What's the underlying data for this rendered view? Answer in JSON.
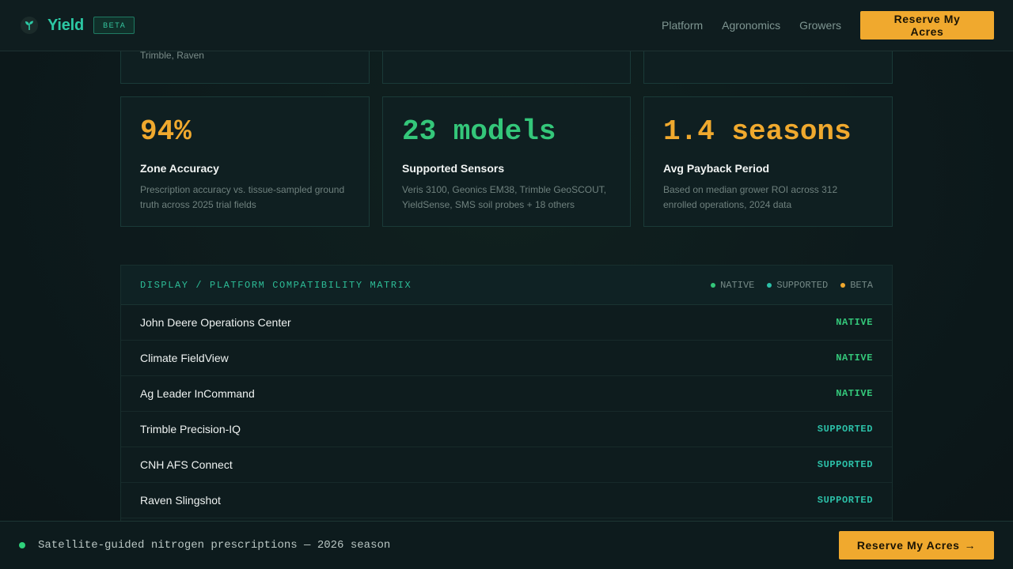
{
  "colors": {
    "accent": "#2cc8a4",
    "cta": "#f0a92e",
    "native": "#34c77a",
    "supported": "#2cc0a8",
    "beta": "#f0a92e",
    "stat_orange": "#f0a92e",
    "stat_green": "#34c77a"
  },
  "nav": {
    "logo_icon": "sprout-icon",
    "brand": "Yield",
    "badge": "BETA",
    "links": [
      "Platform",
      "Agronomics",
      "Growers"
    ],
    "cta_label": "Reserve My Acres"
  },
  "partial_cards": [
    {
      "text": "Trimble, Raven"
    },
    {
      "text": ""
    },
    {
      "text": ""
    }
  ],
  "stats": [
    {
      "value": "94%",
      "label": "Zone Accuracy",
      "desc": "Prescription accuracy vs. tissue-sampled ground truth across 2025 trial fields",
      "color": "#f0a92e"
    },
    {
      "value": "23 models",
      "label": "Supported Sensors",
      "desc": "Veris 3100, Geonics EM38, Trimble GeoSCOUT, YieldSense, SMS soil probes + 18 others",
      "color": "#34c77a"
    },
    {
      "value": "1.4 seasons",
      "label": "Avg Payback Period",
      "desc": "Based on median grower ROI across 312 enrolled operations, 2024 data",
      "color": "#f0a92e"
    }
  ],
  "matrix": {
    "title": "DISPLAY / PLATFORM COMPATIBILITY MATRIX",
    "legend": [
      {
        "label": "NATIVE",
        "color": "#34c77a"
      },
      {
        "label": "SUPPORTED",
        "color": "#2cc0a8"
      },
      {
        "label": "BETA",
        "color": "#f0a92e"
      }
    ],
    "rows": [
      {
        "name": "John Deere Operations Center",
        "status": "NATIVE"
      },
      {
        "name": "Climate FieldView",
        "status": "NATIVE"
      },
      {
        "name": "Ag Leader InCommand",
        "status": "NATIVE"
      },
      {
        "name": "Trimble Precision-IQ",
        "status": "SUPPORTED"
      },
      {
        "name": "CNH AFS Connect",
        "status": "SUPPORTED"
      },
      {
        "name": "Raven Slingshot",
        "status": "SUPPORTED"
      }
    ]
  },
  "sticky": {
    "text": "Satellite-guided nitrogen prescriptions — 2026 season",
    "cta_label": "Reserve My Acres",
    "cta_arrow": "→"
  }
}
